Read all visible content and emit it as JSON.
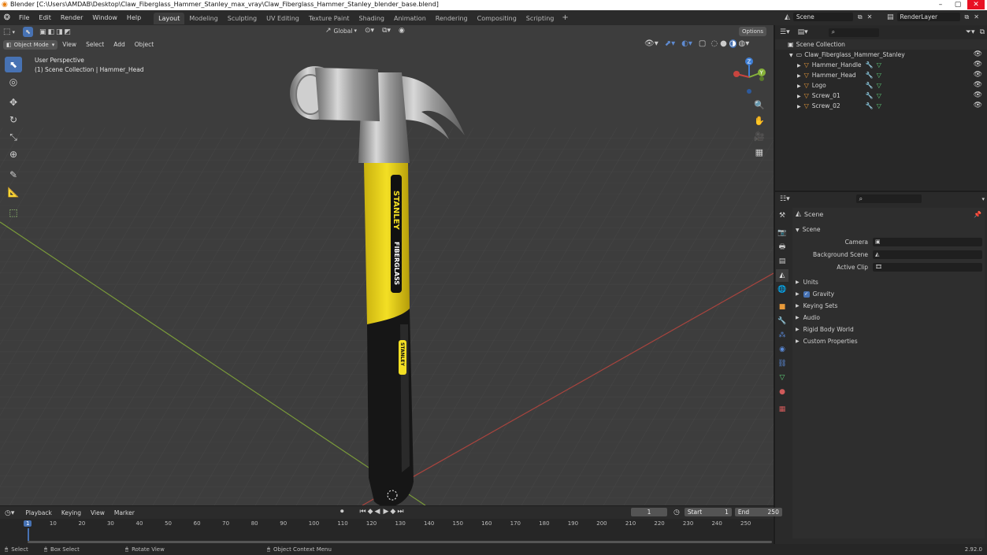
{
  "window": {
    "title": "Blender [C:\\Users\\AMDAB\\Desktop\\Claw_Fiberglass_Hammer_Stanley_max_vray\\Claw_Fiberglass_Hammer_Stanley_blender_base.blend]",
    "controls": [
      "–",
      "▢",
      "✕"
    ]
  },
  "menu": [
    "File",
    "Edit",
    "Render",
    "Window",
    "Help"
  ],
  "workspaces": [
    "Layout",
    "Modeling",
    "Sculpting",
    "UV Editing",
    "Texture Paint",
    "Shading",
    "Animation",
    "Rendering",
    "Compositing",
    "Scripting"
  ],
  "active_workspace": "Layout",
  "scene_name": "Scene",
  "render_layer": "RenderLayer",
  "viewport": {
    "mode": "Object Mode",
    "header_menu": [
      "View",
      "Select",
      "Add",
      "Object"
    ],
    "transform_orientation": "Global",
    "options_label": "Options",
    "overlay_title": "User Perspective",
    "overlay_subtitle": "(1) Scene Collection | Hammer_Head",
    "gizmo_axes": [
      "Z",
      "Y",
      "X"
    ],
    "model_texts": {
      "brand_handle": "STANLEY",
      "fiberglass": "FIBERGLASS",
      "brand_grip": "STANLEY"
    }
  },
  "outliner": {
    "root": "Scene Collection",
    "collection": "Claw_Fiberglass_Hammer_Stanley",
    "items": [
      "Hammer_Handle",
      "Hammer_Head",
      "Logo",
      "Screw_01",
      "Screw_02"
    ]
  },
  "properties": {
    "context": "Scene",
    "panel": "Scene",
    "fields": [
      {
        "label": "Camera",
        "value": ""
      },
      {
        "label": "Background Scene",
        "value": ""
      },
      {
        "label": "Active Clip",
        "value": ""
      }
    ],
    "sections": [
      {
        "label": "Units",
        "checkbox": false
      },
      {
        "label": "Gravity",
        "checkbox": true
      },
      {
        "label": "Keying Sets",
        "checkbox": false
      },
      {
        "label": "Audio",
        "checkbox": false
      },
      {
        "label": "Rigid Body World",
        "checkbox": false
      },
      {
        "label": "Custom Properties",
        "checkbox": false
      }
    ]
  },
  "timeline": {
    "menu": [
      "Playback",
      "Keying",
      "View",
      "Marker"
    ],
    "current_frame": "1",
    "start_label": "Start",
    "start": "1",
    "end_label": "End",
    "end": "250",
    "frame_marks": [
      "1",
      "10",
      "20",
      "30",
      "40",
      "50",
      "60",
      "70",
      "80",
      "90",
      "100",
      "110",
      "120",
      "130",
      "140",
      "150",
      "160",
      "170",
      "180",
      "190",
      "200",
      "210",
      "220",
      "230",
      "240",
      "250"
    ]
  },
  "statusbar": {
    "hints": [
      "Select",
      "Box Select",
      "Rotate View",
      "Object Context Menu"
    ],
    "version": "2.92.0"
  },
  "colors": {
    "accent": "#4772b3",
    "x_axis": "#c8453f",
    "y_axis": "#86b23a",
    "z_axis": "#3f7fd6",
    "handle_yellow": "#f1dc1c"
  }
}
